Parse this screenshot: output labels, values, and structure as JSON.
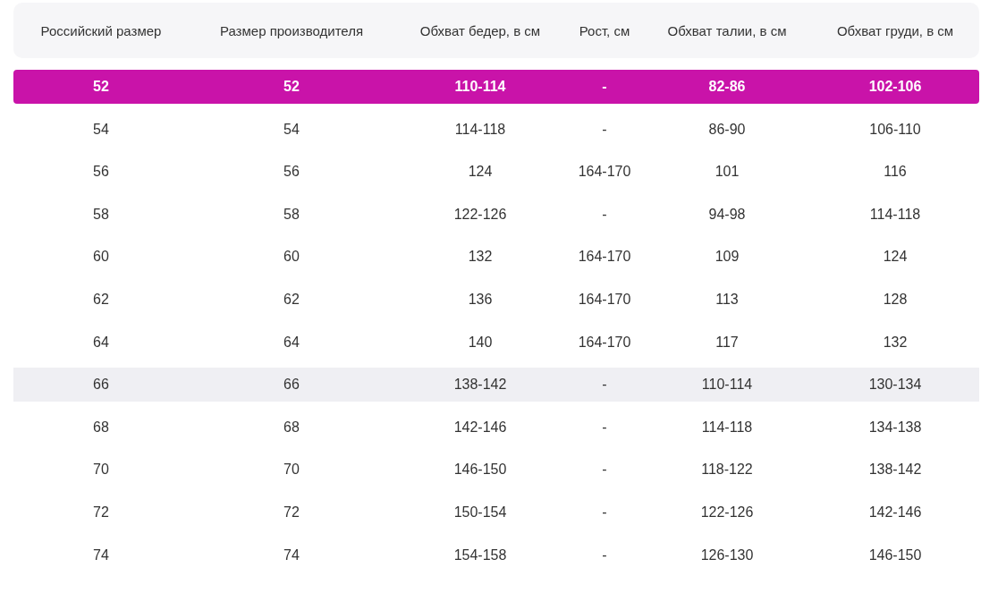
{
  "table": {
    "columns": [
      "Российский размер",
      "Размер производителя",
      "Обхват бедер, в см",
      "Рост, см",
      "Обхват талии, в см",
      "Обхват груди, в см"
    ],
    "rows": [
      {
        "cells": [
          "52",
          "52",
          "110-114",
          "-",
          "82-86",
          "102-106"
        ],
        "selected": true,
        "hovered": false
      },
      {
        "cells": [
          "54",
          "54",
          "114-118",
          "-",
          "86-90",
          "106-110"
        ],
        "selected": false,
        "hovered": false
      },
      {
        "cells": [
          "56",
          "56",
          "124",
          "164-170",
          "101",
          "116"
        ],
        "selected": false,
        "hovered": false
      },
      {
        "cells": [
          "58",
          "58",
          "122-126",
          "-",
          "94-98",
          "114-118"
        ],
        "selected": false,
        "hovered": false
      },
      {
        "cells": [
          "60",
          "60",
          "132",
          "164-170",
          "109",
          "124"
        ],
        "selected": false,
        "hovered": false
      },
      {
        "cells": [
          "62",
          "62",
          "136",
          "164-170",
          "113",
          "128"
        ],
        "selected": false,
        "hovered": false
      },
      {
        "cells": [
          "64",
          "64",
          "140",
          "164-170",
          "117",
          "132"
        ],
        "selected": false,
        "hovered": false
      },
      {
        "cells": [
          "66",
          "66",
          "138-142",
          "-",
          "110-114",
          "130-134"
        ],
        "selected": false,
        "hovered": true
      },
      {
        "cells": [
          "68",
          "68",
          "142-146",
          "-",
          "114-118",
          "134-138"
        ],
        "selected": false,
        "hovered": false
      },
      {
        "cells": [
          "70",
          "70",
          "146-150",
          "-",
          "118-122",
          "138-142"
        ],
        "selected": false,
        "hovered": false
      },
      {
        "cells": [
          "72",
          "72",
          "150-154",
          "-",
          "122-126",
          "142-146"
        ],
        "selected": false,
        "hovered": false
      },
      {
        "cells": [
          "74",
          "74",
          "154-158",
          "-",
          "126-130",
          "146-150"
        ],
        "selected": false,
        "hovered": false
      }
    ]
  }
}
